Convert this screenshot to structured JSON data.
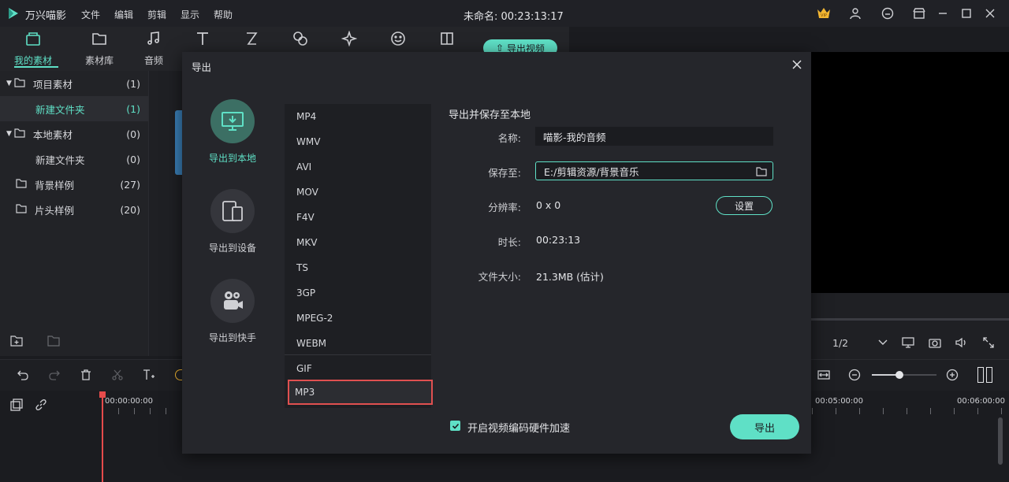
{
  "app": {
    "name": "万兴喵影",
    "menus": [
      "文件",
      "编辑",
      "剪辑",
      "显示",
      "帮助"
    ],
    "doc_title": "未命名: 00:23:13:17"
  },
  "toolbar": {
    "tabs": [
      "我的素材",
      "素材库",
      "音频"
    ],
    "export_video": "导出视频"
  },
  "sidebar": {
    "items": [
      {
        "label": "项目素材",
        "count": "(1)"
      },
      {
        "label": "新建文件夹",
        "count": "(1)"
      },
      {
        "label": "本地素材",
        "count": "(0)"
      },
      {
        "label": "新建文件夹",
        "count": "(0)"
      },
      {
        "label": "背景样例",
        "count": "(27)"
      },
      {
        "label": "片头样例",
        "count": "(20)"
      }
    ]
  },
  "preview": {
    "page": "1/2"
  },
  "timeline": {
    "time_start": "00:00:00:00",
    "time_mark1": "00:05:00:00",
    "time_mark2": "00:06:00:00"
  },
  "export_dialog": {
    "title": "导出",
    "destinations": [
      "导出到本地",
      "导出到设备",
      "导出到快手"
    ],
    "formats": [
      "MP4",
      "WMV",
      "AVI",
      "MOV",
      "F4V",
      "MKV",
      "TS",
      "3GP",
      "MPEG-2",
      "WEBM",
      "GIF",
      "MP3"
    ],
    "selected_format": "MP3",
    "section_title": "导出并保存至本地",
    "name_label": "名称:",
    "name_value": "喵影-我的音频",
    "save_label": "保存至:",
    "save_value": "E:/剪辑资源/背景音乐",
    "resolution_label": "分辨率:",
    "resolution_value": "0 x 0",
    "settings_button": "设置",
    "duration_label": "时长:",
    "duration_value": "00:23:13",
    "filesize_label": "文件大小:",
    "filesize_value": "21.3MB (估计)",
    "hw_accel_label": "开启视频编码硬件加速",
    "export_button": "导出"
  },
  "colors": {
    "accent": "#5fe0c6",
    "selection_outline": "#e05050"
  }
}
